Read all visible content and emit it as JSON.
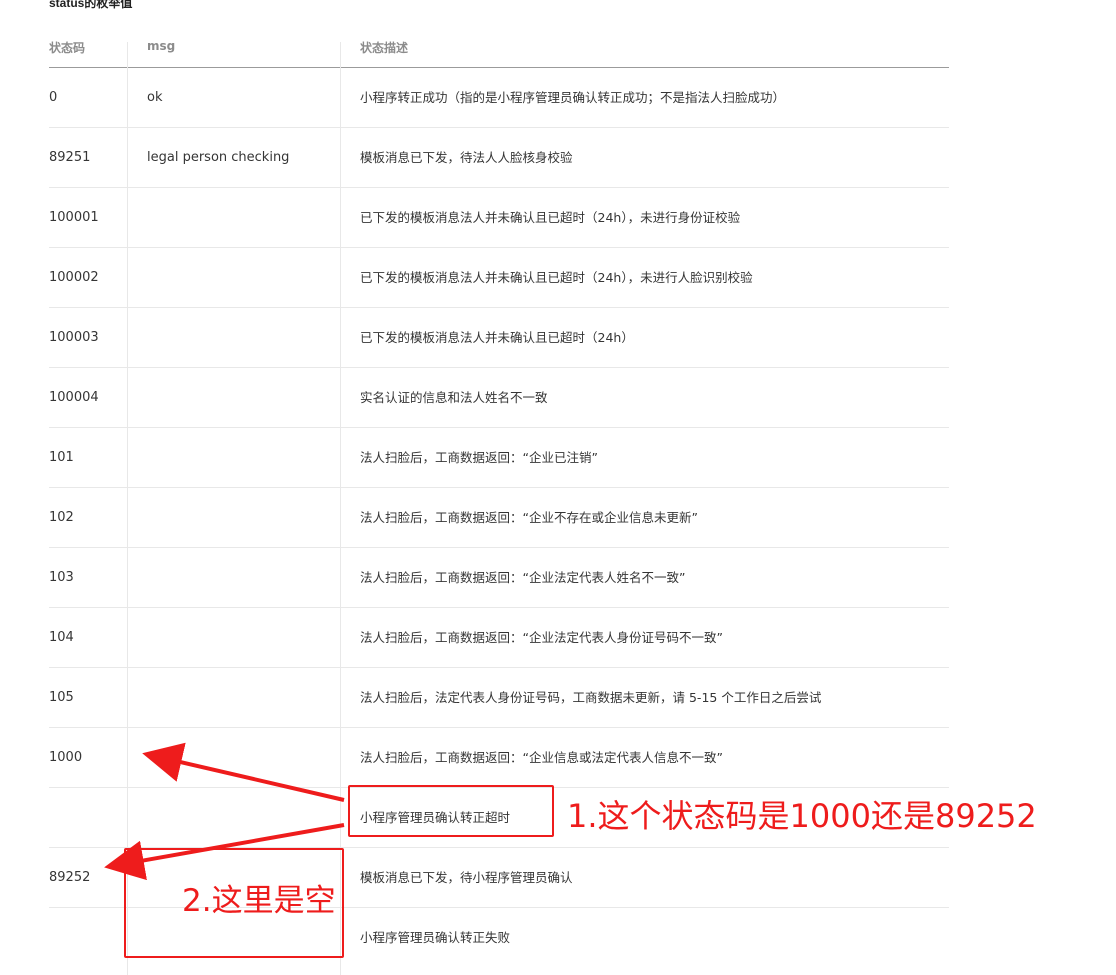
{
  "section_title": "status的枚举值",
  "columns": {
    "code": "状态码",
    "msg": "msg",
    "desc": "状态描述"
  },
  "rows": [
    {
      "code": "0",
      "msg": "ok",
      "desc": "小程序转正成功（指的是小程序管理员确认转正成功；不是指法人扫脸成功）"
    },
    {
      "code": "89251",
      "msg": "legal person checking",
      "desc": "模板消息已下发，待法人人脸核身校验"
    },
    {
      "code": "100001",
      "msg": "",
      "desc": "已下发的模板消息法人并未确认且已超时（24h），未进行身份证校验"
    },
    {
      "code": "100002",
      "msg": "",
      "desc": "已下发的模板消息法人并未确认且已超时（24h），未进行人脸识别校验"
    },
    {
      "code": "100003",
      "msg": "",
      "desc": "已下发的模板消息法人并未确认且已超时（24h）"
    },
    {
      "code": "100004",
      "msg": "",
      "desc": "实名认证的信息和法人姓名不一致"
    },
    {
      "code": "101",
      "msg": "",
      "desc": "法人扫脸后，工商数据返回：“企业已注销”"
    },
    {
      "code": "102",
      "msg": "",
      "desc": "法人扫脸后，工商数据返回：“企业不存在或企业信息未更新”"
    },
    {
      "code": "103",
      "msg": "",
      "desc": "法人扫脸后，工商数据返回：“企业法定代表人姓名不一致”"
    },
    {
      "code": "104",
      "msg": "",
      "desc": "法人扫脸后，工商数据返回：“企业法定代表人身份证号码不一致”"
    },
    {
      "code": "105",
      "msg": "",
      "desc": "法人扫脸后，法定代表人身份证号码，工商数据未更新，请 5-15 个工作日之后尝试"
    },
    {
      "code": "1000",
      "msg": "",
      "desc": "法人扫脸后，工商数据返回：“企业信息或法定代表人信息不一致”"
    },
    {
      "code": "",
      "msg": "",
      "desc": "小程序管理员确认转正超时"
    },
    {
      "code": "89252",
      "msg": "",
      "desc": "模板消息已下发，待小程序管理员确认"
    },
    {
      "code": "",
      "msg": "",
      "desc": "小程序管理员确认转正失败"
    }
  ],
  "annotations": {
    "note1": "1.这个状态码是1000还是89252",
    "note2": "2.这里是空",
    "color": "#ee1c1c"
  }
}
